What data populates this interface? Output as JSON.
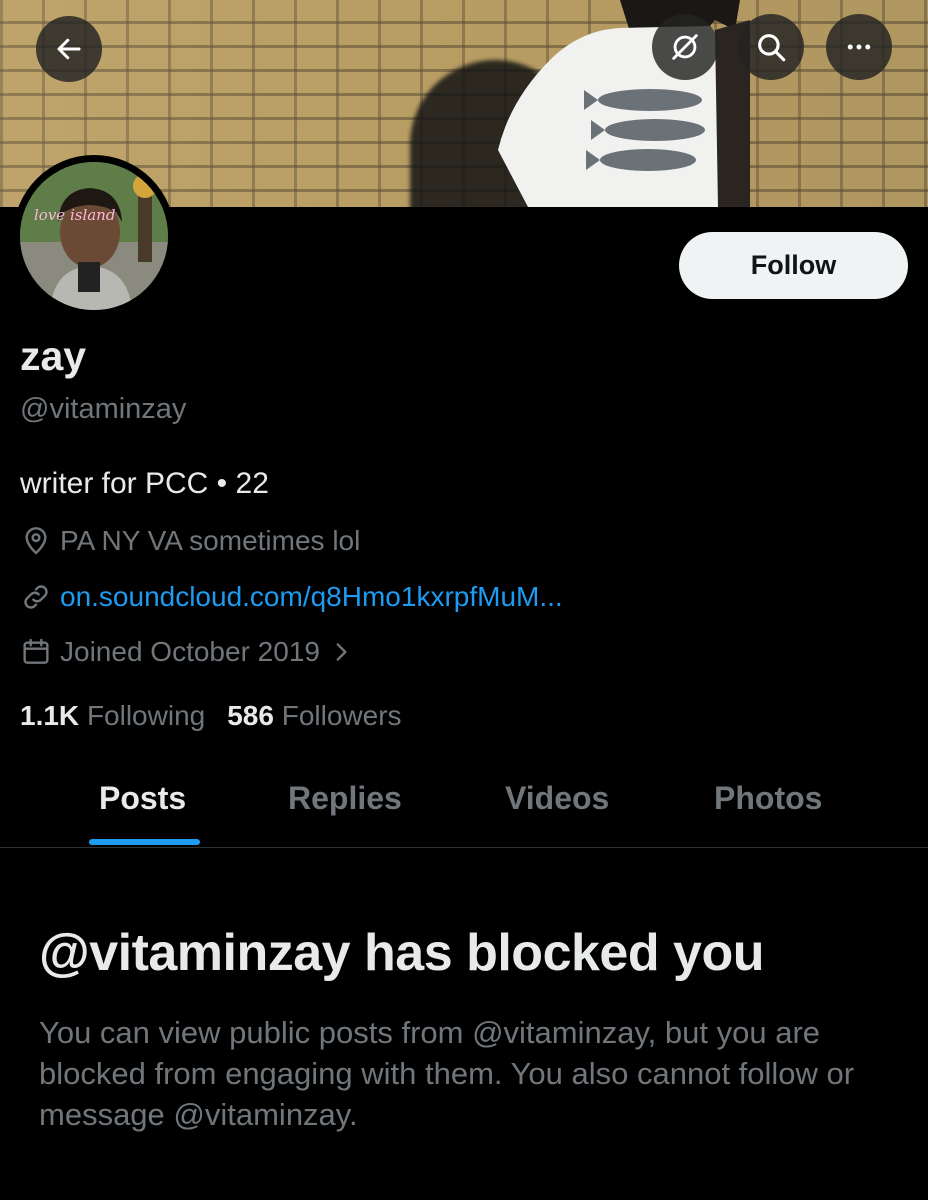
{
  "header": {
    "back_icon": "arrow-left-icon",
    "notifications_icon": "bell-slash-icon",
    "search_icon": "search-icon",
    "more_icon": "more-horizontal-icon"
  },
  "avatar": {
    "overlay_text": "love island"
  },
  "profile": {
    "follow_label": "Follow",
    "display_name": "zay",
    "handle": "@vitaminzay",
    "bio": "writer for PCC • 22",
    "location": "PA NY VA sometimes lol",
    "link": "on.soundcloud.com/q8Hmo1kxrpfMuM...",
    "joined": "Joined October 2019",
    "following_count": "1.1K",
    "following_label": "Following",
    "followers_count": "586",
    "followers_label": "Followers"
  },
  "tabs": [
    {
      "label": "Posts",
      "active": true
    },
    {
      "label": "Replies",
      "active": false
    },
    {
      "label": "Videos",
      "active": false
    },
    {
      "label": "Photos",
      "active": false
    }
  ],
  "blocked": {
    "title": "@vitaminzay has blocked you",
    "message": "You can view public posts from @vitaminzay, but you are blocked from engaging with them. You also cannot follow or message @vitaminzay."
  },
  "colors": {
    "background": "#000000",
    "accent": "#1d9bf0",
    "muted_text": "#71767b",
    "primary_text": "#e7e9ea",
    "follow_button": "#eff3f4"
  }
}
